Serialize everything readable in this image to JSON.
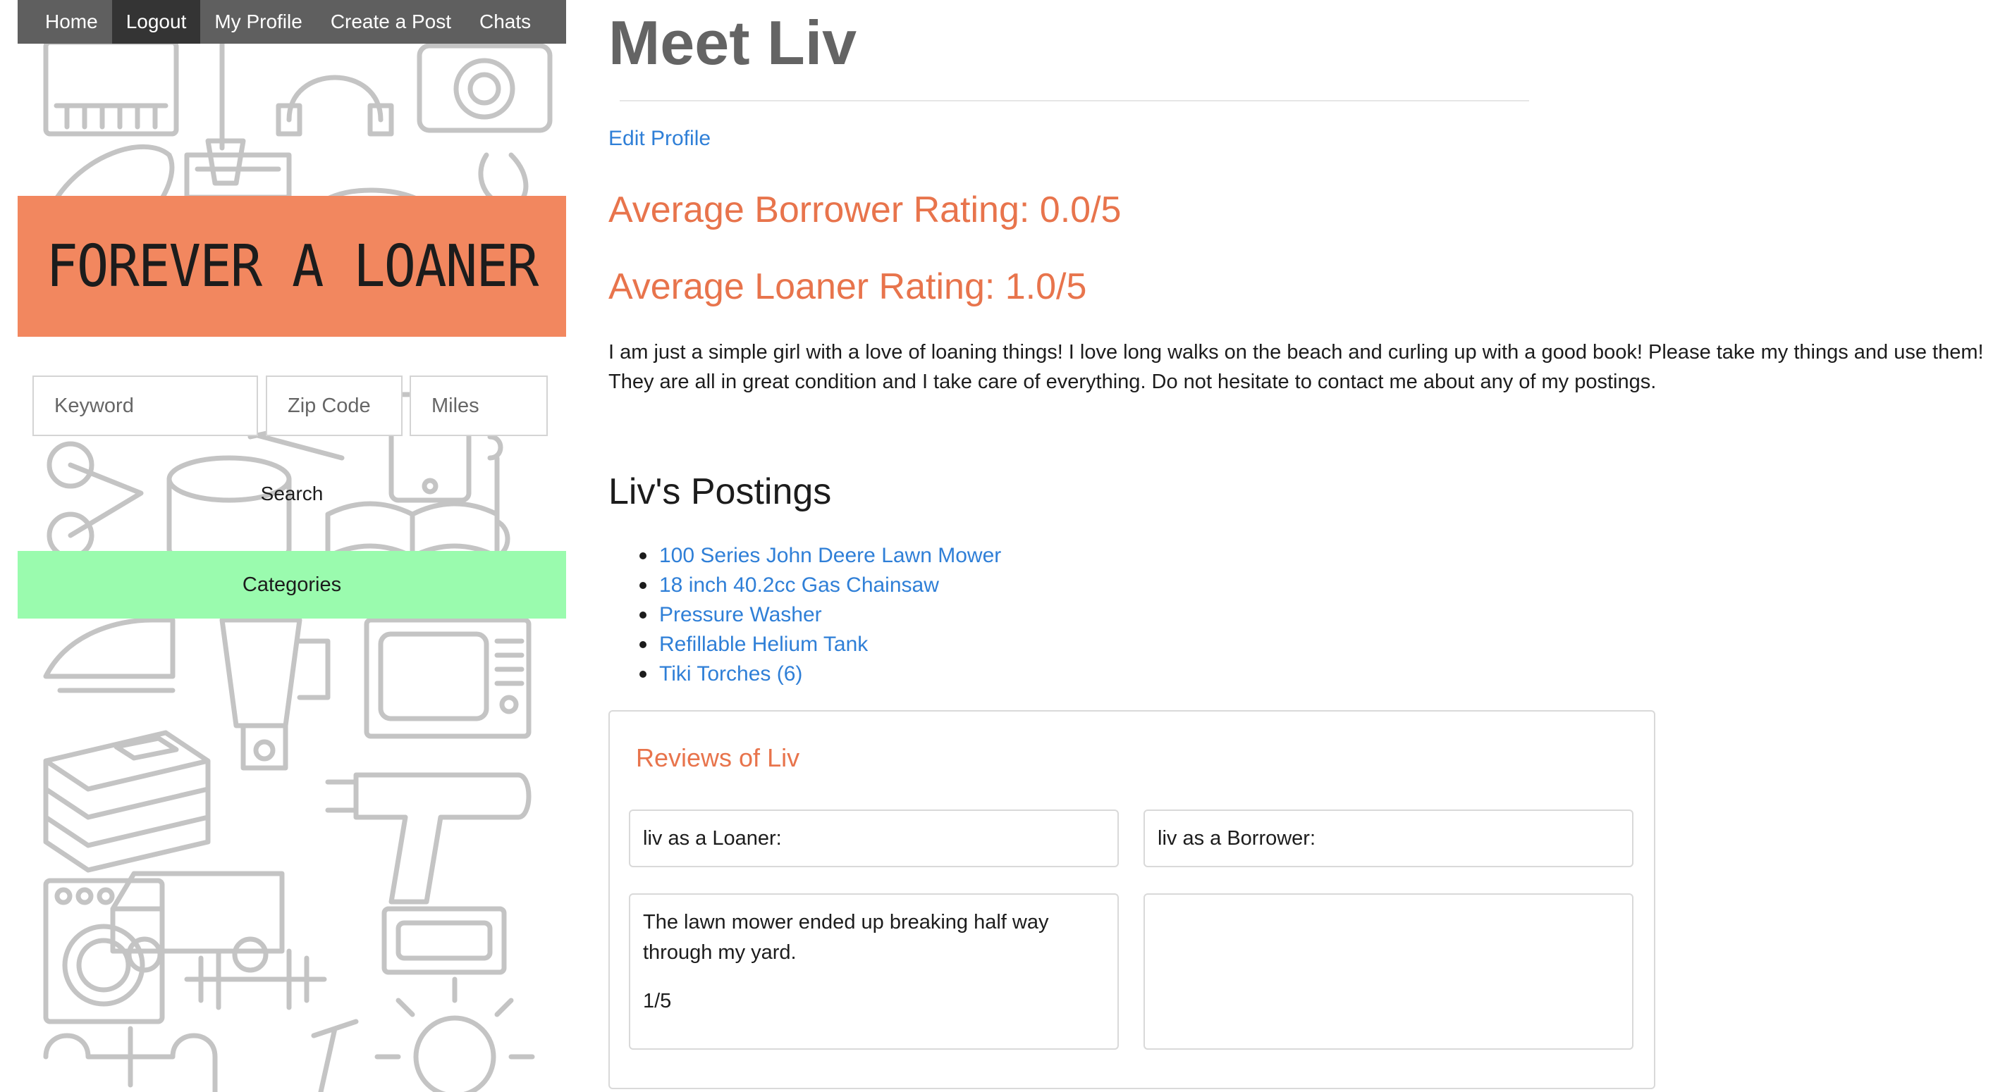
{
  "nav": {
    "items": [
      {
        "label": "Home"
      },
      {
        "label": "Logout"
      },
      {
        "label": "My Profile"
      },
      {
        "label": "Create a Post"
      },
      {
        "label": "Chats"
      }
    ]
  },
  "sidebar": {
    "banner_title": "FOREVER A LOANER",
    "search": {
      "keyword_placeholder": "Keyword",
      "zip_placeholder": "Zip Code",
      "miles_placeholder": "Miles",
      "button_label": "Search"
    },
    "categories_label": "Categories",
    "colors": {
      "banner": "#f2875f",
      "categories": "#9afbae",
      "nav": "#5f5f5f",
      "nav_active": "#343434"
    }
  },
  "profile": {
    "title": "Meet Liv",
    "edit_link": "Edit Profile",
    "borrower_rating": "Average Borrower Rating: 0.0/5",
    "loaner_rating": "Average Loaner Rating: 1.0/5",
    "bio": "I am just a simple girl with a love of loaning things! I love long walks on the beach and curling up with a good book! Please take my things and use them! They are all in great condition and I take care of everything. Do not hesitate to contact me about any of my postings."
  },
  "postings": {
    "title": "Liv's Postings",
    "items": [
      {
        "label": "100 Series John Deere Lawn Mower"
      },
      {
        "label": "18 inch 40.2cc Gas Chainsaw"
      },
      {
        "label": "Pressure Washer"
      },
      {
        "label": "Refillable Helium Tank"
      },
      {
        "label": "Tiki Torches (6)"
      }
    ]
  },
  "reviews": {
    "title": "Reviews of Liv",
    "loaner_header": "liv as a Loaner:",
    "borrower_header": "liv as a Borrower:",
    "loaner_reviews": [
      {
        "text": "The lawn mower ended up breaking half way through my yard.",
        "score": "1/5"
      }
    ],
    "borrower_reviews": []
  },
  "colors": {
    "accent": "#e8744c",
    "link": "#2f7fd7",
    "title": "#646464"
  }
}
